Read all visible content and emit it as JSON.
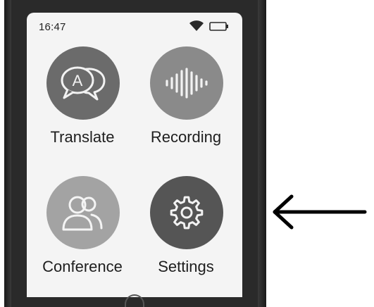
{
  "status_bar": {
    "time": "16:47",
    "wifi_icon": "wifi-icon",
    "battery_icon": "battery-icon"
  },
  "apps": [
    {
      "label": "Translate",
      "icon": "translate-icon",
      "color": "#6b6b6b"
    },
    {
      "label": "Recording",
      "icon": "waveform-icon",
      "color": "#8a8a8a"
    },
    {
      "label": "Conference",
      "icon": "users-icon",
      "color": "#a3a3a3"
    },
    {
      "label": "Settings",
      "icon": "gear-icon",
      "color": "#555555"
    }
  ],
  "colors": {
    "device": "#2a2a2a",
    "screen": "#f4f4f4",
    "text": "#1e1e1e",
    "arrow": "#000000"
  },
  "annotation": {
    "arrow_icon": "left-arrow-icon"
  }
}
